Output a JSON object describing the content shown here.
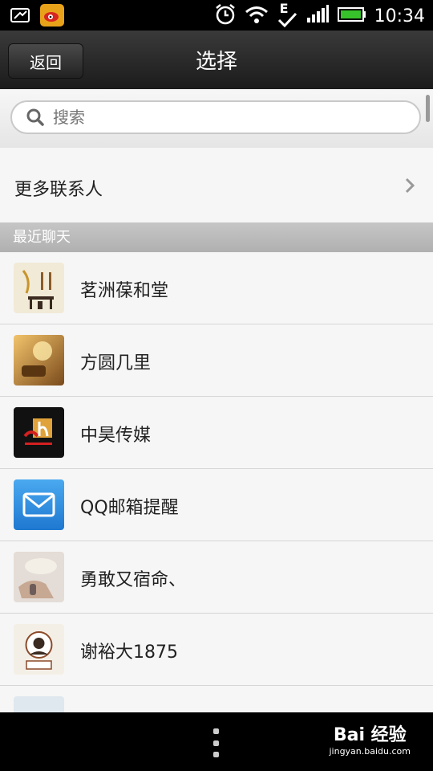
{
  "status_bar": {
    "time": "10:34",
    "network": "E"
  },
  "header": {
    "back_label": "返回",
    "title": "选择"
  },
  "search": {
    "placeholder": "搜索",
    "value": ""
  },
  "more_contacts": {
    "label": "更多联系人"
  },
  "section": {
    "recent_label": "最近聊天"
  },
  "contacts": [
    {
      "name": "茗洲葆和堂",
      "avatar_color": "#efe8d4"
    },
    {
      "name": "方圆几里",
      "avatar_color": "#c98b3a"
    },
    {
      "name": "中昊传媒",
      "avatar_color": "#111111"
    },
    {
      "name": "QQ邮箱提醒",
      "avatar_color": "#2f8fe0"
    },
    {
      "name": "勇敢又宿命、",
      "avatar_color": "#d9cdc4"
    },
    {
      "name": "谢裕大1875",
      "avatar_color": "#f1ece4"
    }
  ],
  "watermark": {
    "logo": "Bai 经验",
    "url": "jingyan.baidu.com"
  }
}
